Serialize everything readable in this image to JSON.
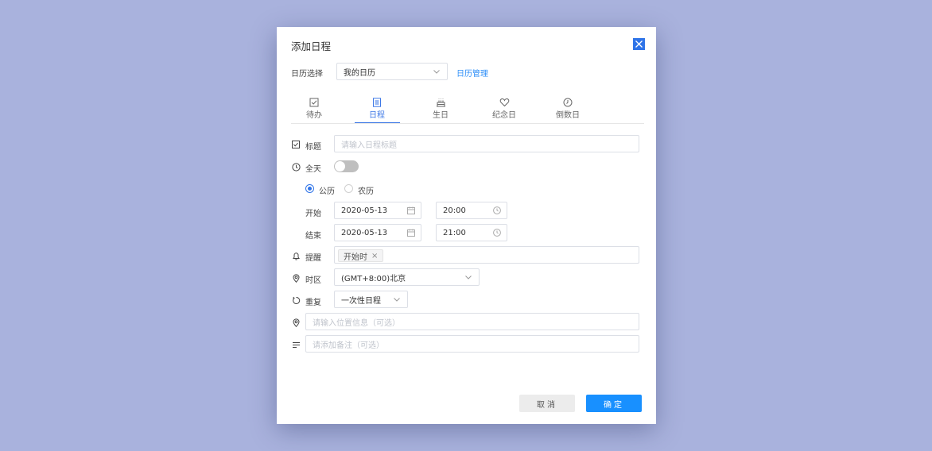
{
  "dialog": {
    "title": "添加日程"
  },
  "calendar_select": {
    "label": "日历选择",
    "value": "我的日历",
    "manage_link": "日历管理"
  },
  "tabs": [
    {
      "label": "待办",
      "icon": "checkbox-icon"
    },
    {
      "label": "日程",
      "icon": "document-icon",
      "active": true
    },
    {
      "label": "生日",
      "icon": "cake-icon"
    },
    {
      "label": "纪念日",
      "icon": "heart-icon"
    },
    {
      "label": "倒数日",
      "icon": "clock-icon"
    }
  ],
  "form": {
    "title_label": "标题",
    "title_placeholder": "请输入日程标题",
    "allday_label": "全天",
    "allday_on": false,
    "calendar_types": [
      "公历",
      "农历"
    ],
    "start_label": "开始",
    "start_date": "2020-05-13",
    "start_time": "20:00",
    "end_label": "结束",
    "end_date": "2020-05-13",
    "end_time": "21:00",
    "reminder_label": "提醒",
    "reminder_tag": "开始时",
    "reminder_tag_close": "×",
    "timezone_label": "时区",
    "timezone_value": "(GMT+8:00)北京",
    "repeat_label": "重复",
    "repeat_value": "一次性日程",
    "location_placeholder": "请输入位置信息（可选）",
    "note_placeholder": "请添加备注（可选）"
  },
  "footer": {
    "cancel": "取消",
    "ok": "确定"
  },
  "colors": {
    "background": "#a9b2dd",
    "accent": "#1890ff",
    "tab_active": "#3d78e6"
  }
}
